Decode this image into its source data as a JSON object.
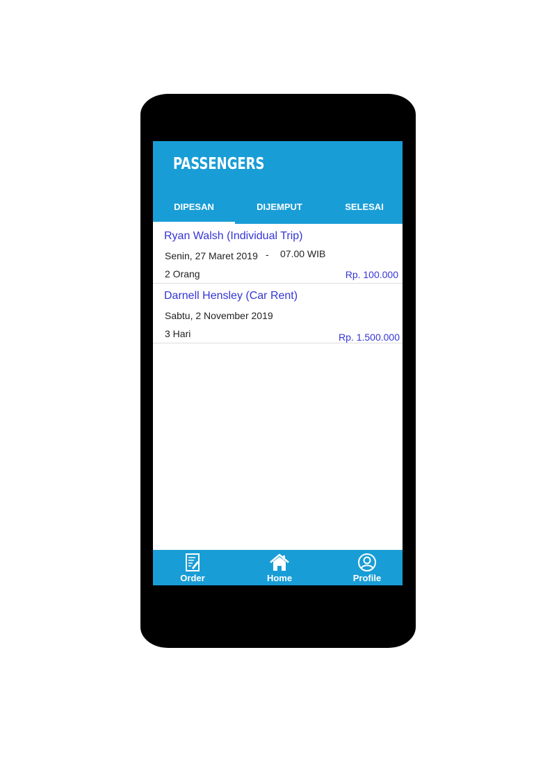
{
  "app": {
    "title": "PASSENGERS"
  },
  "tabs": [
    {
      "label": "DIPESAN",
      "active": true
    },
    {
      "label": "DIJEMPUT",
      "active": false
    },
    {
      "label": "SELESAI",
      "active": false
    }
  ],
  "orders": [
    {
      "name": "Ryan Walsh (Individual Trip)",
      "date": "Senin, 27 Maret 2019",
      "separator": "-",
      "time": "07.00 WIB",
      "quantity": "2 Orang",
      "price": "Rp. 100.000"
    },
    {
      "name": "Darnell Hensley (Car Rent)",
      "date": "Sabtu, 2 November 2019",
      "quantity": "3 Hari",
      "price": "Rp. 1.500.000"
    }
  ],
  "bottom_nav": [
    {
      "label": "Order",
      "icon": "order-icon"
    },
    {
      "label": "Home",
      "icon": "home-icon"
    },
    {
      "label": "Profile",
      "icon": "profile-icon"
    }
  ],
  "colors": {
    "primary": "#199dd6",
    "link": "#3434d6",
    "frame": "#000000"
  }
}
